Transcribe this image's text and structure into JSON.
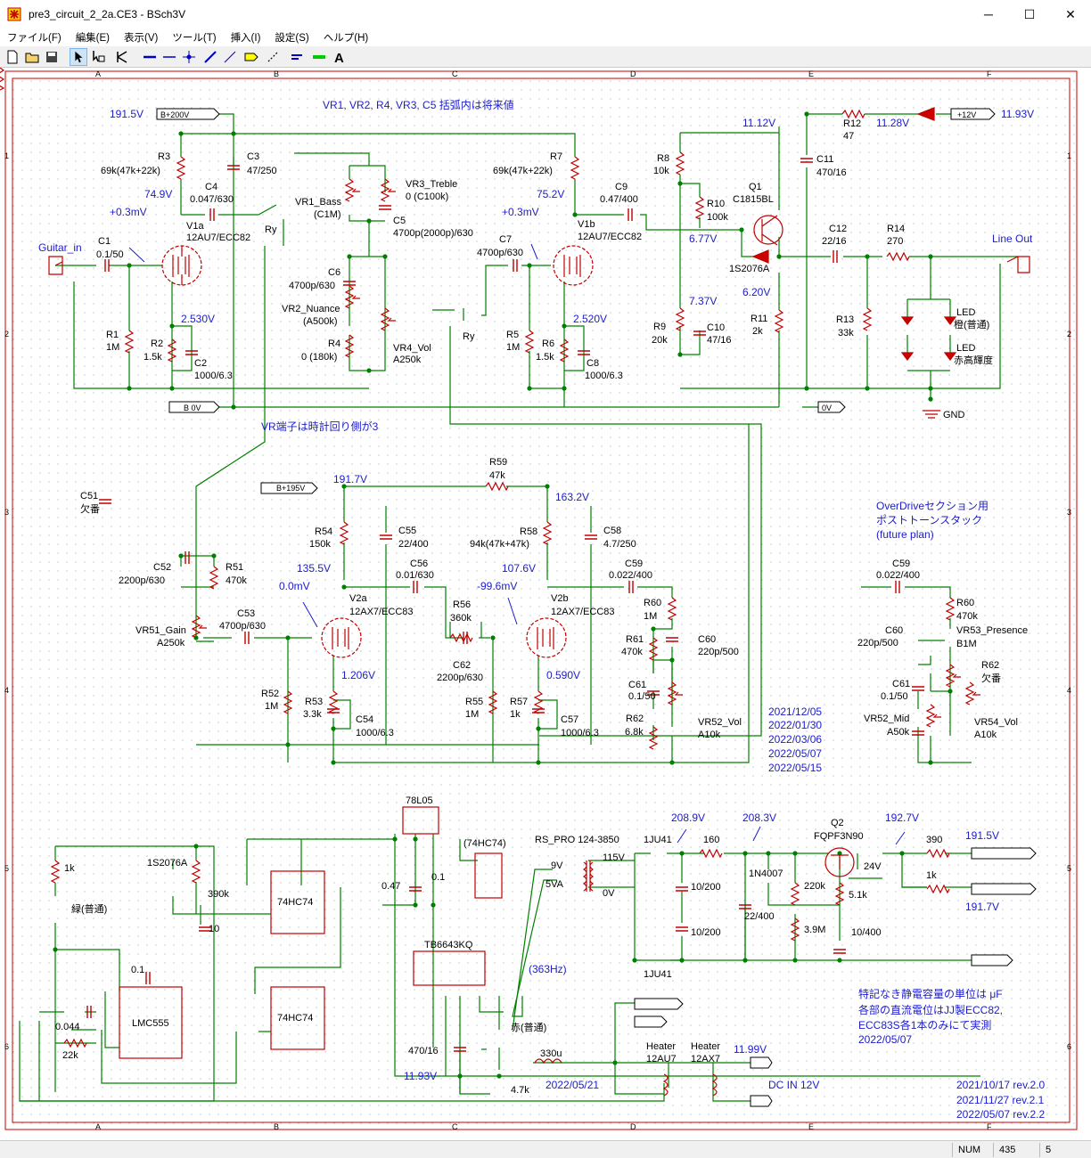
{
  "window": {
    "title": "pre3_circuit_2_2a.CE3 - BSch3V",
    "minimize": "─",
    "maximize": "☐",
    "close": "✕"
  },
  "menu": [
    "ファイル(F)",
    "編集(E)",
    "表示(V)",
    "ツール(T)",
    "挿入(I)",
    "設定(S)",
    "ヘルプ(H)"
  ],
  "toolbar": {
    "tools": [
      "new-icon",
      "open-icon",
      "save-icon",
      "select-icon",
      "drag-icon",
      "tag-icon",
      "wire-icon",
      "bus-icon",
      "junction-icon",
      "entry-icon",
      "dash-icon",
      "tag-icon",
      "comment-icon",
      "label-icon",
      "entry-bus-icon",
      "text-icon"
    ]
  },
  "status": {
    "mode": "NUM",
    "x": "435",
    "y": "5"
  },
  "colors": {
    "wire": "#008000",
    "part": "#c00000",
    "text": "#000000",
    "note": "#1c1ccc",
    "sheet_border": "#c00000"
  },
  "grid": {
    "cols": [
      "A",
      "B",
      "C",
      "D",
      "E",
      "F"
    ],
    "rows": [
      "1",
      "2",
      "3",
      "4",
      "5",
      "6"
    ]
  },
  "notes": {
    "vr_note": "VR1, VR2, R4, VR3, C5 括弧内は将来値",
    "vr_terminal": "VR端子は時計回り側が3",
    "od_note1": "OverDriveセクション用",
    "od_note2": "ポストトーンスタック",
    "od_note3": "(future plan)",
    "cap_note1": "特記なき静電容量の単位は μF",
    "cap_note2": "各部の直流電位はJJ製ECC82,",
    "cap_note3": "ECC83S各1本のみにて実測",
    "cap_note4": "2022/05/07",
    "rev1": "2021/10/17 rev.2.0",
    "rev2": "2021/11/27 rev.2.1",
    "rev3": "2022/05/07 rev.2.2",
    "date1": "2021/12/05",
    "date2": "2022/01/30",
    "date3": "2022/03/06",
    "date4": "2022/05/07",
    "date5": "2022/05/15",
    "date_psu": "2022/05/21"
  },
  "voltages": {
    "v1915": "191.5V",
    "v749": "74.9V",
    "v03a": "+0.3mV",
    "v2530": "2.530V",
    "v752": "75.2V",
    "v03b": "+0.3mV",
    "v2520": "2.520V",
    "v1112": "11.12V",
    "v1128": "11.28V",
    "v1193": "11.93V",
    "v677": "6.77V",
    "v737": "7.37V",
    "v620": "6.20V",
    "v1917": "191.7V",
    "v1632": "163.2V",
    "v1355": "135.5V",
    "v00": "0.0mV",
    "v1076": "107.6V",
    "v996": "-99.6mV",
    "v1206": "1.206V",
    "v0590": "0.590V",
    "v2089": "208.9V",
    "v2083": "208.3V",
    "v1927": "192.7V",
    "v1915b": "191.5V",
    "v1917b": "191.7V",
    "v363": "(363Hz)",
    "v1193b": "11.93V",
    "v1199": "11.99V"
  },
  "labels": {
    "bp200": "B+200V",
    "b0v": "B 0V",
    "p12": "+12V",
    "ov": "0V",
    "bp195": "B+195V",
    "gnd": "GND",
    "guitar_in": "Guitar_in",
    "line_out": "Line Out",
    "dc_in": "DC IN 12V",
    "r3": "R3",
    "r3v": "69k(47k+22k)",
    "c3": "C3",
    "c3v": "47/250",
    "c4": "C4",
    "c4v": "0.047/630",
    "c1": "C1",
    "c1v": "0.1/50",
    "r1": "R1",
    "r1v": "1M",
    "r2": "R2",
    "r2v": "1.5k",
    "c2": "C2",
    "c2v": "1000/6.3",
    "v1a": "V1a",
    "v1av": "12AU7/ECC82",
    "ry1": "Ry",
    "ry2": "Ry",
    "vr1": "VR1_Bass",
    "vr1v": "(C1M)",
    "vr3": "VR3_Treble",
    "vr3v": "0 (C100k)",
    "c5": "C5",
    "c5v": "4700p(2000p)/630",
    "c6": "C6",
    "c6v": "4700p/630",
    "vr2": "VR2_Nuance",
    "vr2v": "(A500k)",
    "r4": "R4",
    "r4v": "0 (180k)",
    "vr4": "VR4_Vol",
    "vr4v": "A250k",
    "r7": "R7",
    "r7v": "69k(47k+22k)",
    "c7": "C7",
    "c7v": "4700p/630",
    "c9": "C9",
    "c9v": "0.47/400",
    "v1b": "V1b",
    "v1bv": "12AU7/ECC82",
    "r5": "R5",
    "r5v": "1M",
    "r6": "R6",
    "r6v": "1.5k",
    "c8": "C8",
    "c8v": "1000/6.3",
    "r8": "R8",
    "r8v": "10k",
    "r10": "R10",
    "r10v": "100k",
    "q1": "Q1",
    "q1v": "C1815BL",
    "d1": "1S2076A",
    "r9": "R9",
    "r9v": "20k",
    "c10": "C10",
    "c10v": "47/16",
    "r11": "R11",
    "r11v": "2k",
    "r12": "R12",
    "r12v": "47",
    "c11": "C11",
    "c11v": "470/16",
    "c12": "C12",
    "c12v": "22/16",
    "r14": "R14",
    "r14v": "270",
    "r13": "R13",
    "r13v": "33k",
    "led1": "LED",
    "led1v": "橙(普通)",
    "led2": "LED",
    "led2v": "赤高輝度",
    "c51": "C51",
    "c51v": "欠番",
    "c52": "C52",
    "c52v": "2200p/630",
    "r51": "R51",
    "r51v": "470k",
    "vr51": "VR51_Gain",
    "vr51v": "A250k",
    "c53": "C53",
    "c53v": "4700p/630",
    "r59": "R59",
    "r59v": "47k",
    "r54": "R54",
    "r54v": "150k",
    "c55": "C55",
    "c55v": "22/400",
    "r58": "R58",
    "r58v": "94k(47k+47k)",
    "c58": "C58",
    "c58v": "4.7/250",
    "c56": "C56",
    "c56v": "0.01/630",
    "r56": "R56",
    "r56v": "360k",
    "c62": "C62",
    "c62v": "2200p/630",
    "v2a": "V2a",
    "v2av": "12AX7/ECC83",
    "v2b": "V2b",
    "v2bv": "12AX7/ECC83",
    "c59": "C59",
    "c59v": "0.022/400",
    "r60": "R60",
    "r60v": "1M",
    "r61": "R61",
    "r61v": "470k",
    "c60": "C60",
    "c60v": "220p/500",
    "c61": "C61",
    "c61v": "0.1/50",
    "r62": "R62",
    "r62v": "6.8k",
    "vr52": "VR52_Vol",
    "vr52v": "A10k",
    "r52": "R52",
    "r52v": "1M",
    "r53": "R53",
    "r53v": "3.3k",
    "c54": "C54",
    "c54v": "1000/6.3",
    "r55": "R55",
    "r55v": "1M",
    "r57": "R57",
    "r57v": "1k",
    "c57": "C57",
    "c57v": "1000/6.3",
    "c59f": "C59",
    "c59fv": "0.022/400",
    "r60f": "R60",
    "r60fv": "470k",
    "c60f": "C60",
    "c60fv": "220p/500",
    "vr53": "VR53_Presence",
    "vr53v": "B1M",
    "r62f": "R62",
    "r62fv": "欠番",
    "c61f": "C61",
    "c61fv": "0.1/50",
    "vr52m": "VR52_Mid",
    "vr52mv": "A50k",
    "vr54": "VR54_Vol",
    "vr54v": "A10k",
    "u78": "78L05",
    "u74": "(74HC74)",
    "ps1k": "1k",
    "d1s": "1S2076A",
    "led_g": "緑(普通)",
    "r390": "390k",
    "c10u": "10",
    "c047": "0.47",
    "c01": "0.1",
    "u555": "LMC555",
    "c01b": "0.1",
    "c0044": "0.044",
    "r22k": "22k",
    "ff1": "74HC74",
    "ff2": "74HC74",
    "tb": "TB6643KQ",
    "c470": "470/16",
    "led_r": "赤(普通)",
    "r47k": "4.7k",
    "l330": "330u",
    "xfmr": "RS_PRO 124-3850",
    "x9v": "9V",
    "x5va": "5VA",
    "x115": "115V",
    "x0v": "0V",
    "d1j1": "1JU41",
    "d1j2": "1JU41",
    "r160": "160",
    "c1020a": "10/200",
    "c1020b": "10/200",
    "d4007": "1N4007",
    "c2240": "22/400",
    "r220k": "220k",
    "r39m": "3.9M",
    "q2": "Q2",
    "q2v": "FQPF3N90",
    "z24": "24V",
    "r51k": "5.1k",
    "c10400": "10/400",
    "r390b": "390",
    "r1kb": "1k",
    "ht1": "Heater",
    "ht1v": "12AU7",
    "ht2": "Heater",
    "ht2v": "12AX7"
  }
}
